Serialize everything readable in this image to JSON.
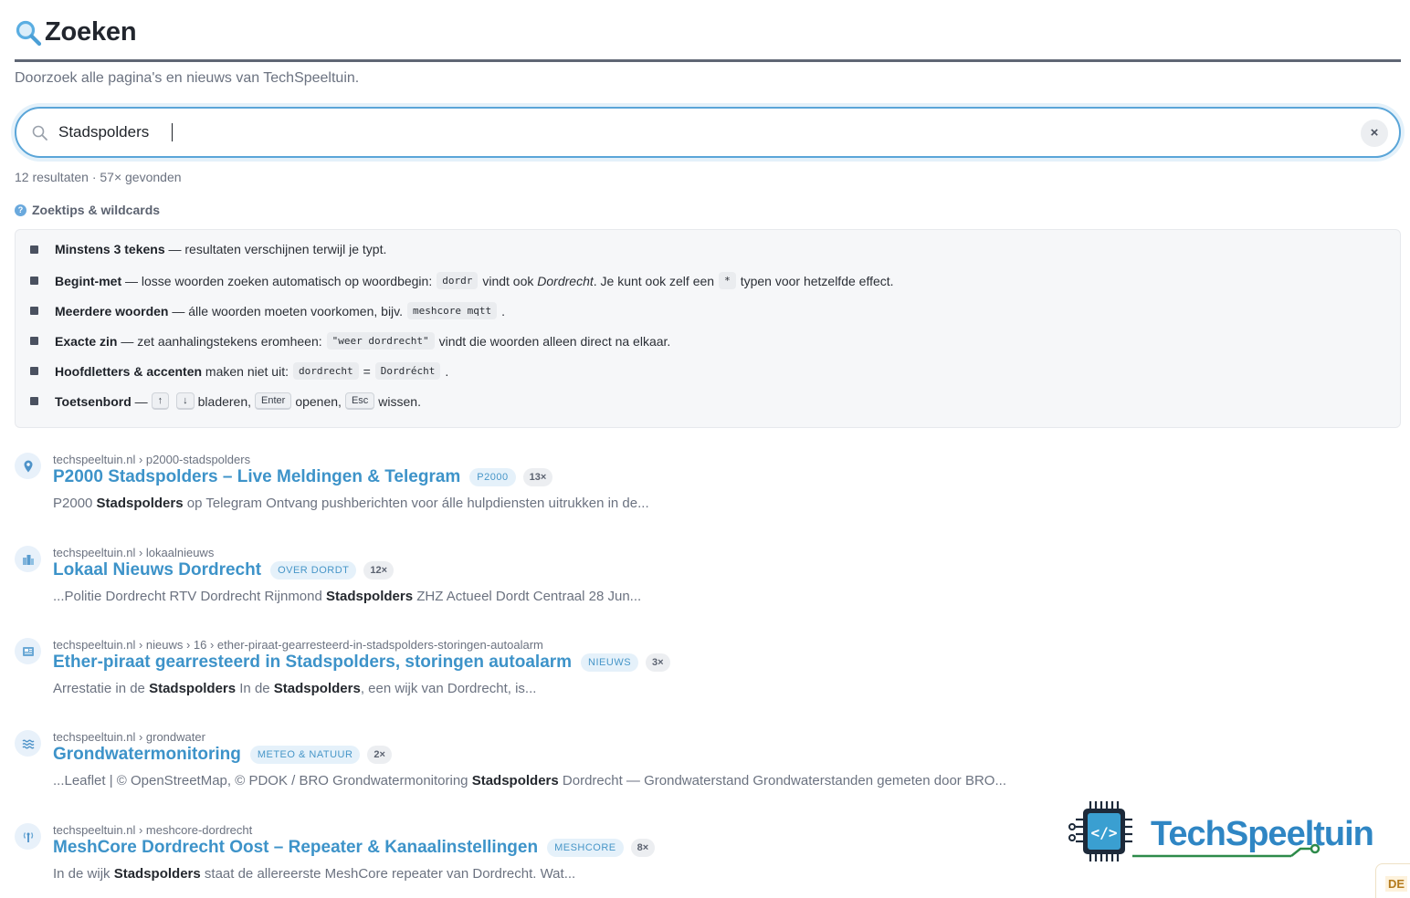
{
  "header": {
    "title": "Zoeken",
    "subtitle": "Doorzoek alle pagina's en nieuws van TechSpeeltuin."
  },
  "search": {
    "value": "Stadspolders",
    "clear_label": "×"
  },
  "meta": {
    "results": "12 resultaten · 57× gevonden"
  },
  "tips": {
    "toggle": "Zoektips & wildcards",
    "toggle_icon": "?",
    "items": [
      {
        "bold": "Minstens 3 tekens",
        "text": " — resultaten verschijnen terwijl je typt."
      },
      {
        "bold": "Begint-met",
        "text_a": " — losse woorden zoeken automatisch op woordbegin:",
        "code_a": "dordr",
        "text_b": "vindt ook ",
        "em": "Dordrecht",
        "text_c": ". Je kunt ook zelf een",
        "code_b": "*",
        "text_d": "typen voor hetzelfde effect."
      },
      {
        "bold": "Meerdere woorden",
        "text_a": " — álle woorden moeten voorkomen, bijv.",
        "code_a": "meshcore mqtt",
        "text_b": "."
      },
      {
        "bold": "Exacte zin",
        "text_a": " — zet aanhalingstekens eromheen:",
        "code_a": "\"weer dordrecht\"",
        "text_b": "vindt die woorden alleen direct na elkaar."
      },
      {
        "bold": "Hoofdletters & accenten",
        "text_a": " maken niet uit:",
        "code_a": "dordrecht",
        "eq": "=",
        "code_b": "Dordrécht",
        "text_b": "."
      },
      {
        "bold": "Toetsenbord",
        "text_a": " —",
        "kbd_a": "↑",
        "kbd_b": "↓",
        "text_b": "bladeren,",
        "kbd_c": "Enter",
        "text_c": "openen,",
        "kbd_d": "Esc",
        "text_d": "wissen."
      }
    ]
  },
  "results": [
    {
      "icon": "map-pin-icon",
      "crumb": "techspeeltuin.nl › p2000-stadspolders",
      "title": "P2000 Stadspolders – Live Meldingen & Telegram",
      "tag": "P2000",
      "count": "13×",
      "snippet": [
        {
          "t": "P2000 "
        },
        {
          "b": "Stadspolders"
        },
        {
          "t": " op Telegram Ontvang pushberichten voor álle hulpdiensten uitrukken in de..."
        }
      ]
    },
    {
      "icon": "city-icon",
      "crumb": "techspeeltuin.nl › lokaalnieuws",
      "title": "Lokaal Nieuws Dordrecht",
      "tag": "Over Dordt",
      "count": "12×",
      "snippet": [
        {
          "t": "...Politie Dordrecht RTV Dordrecht Rijnmond "
        },
        {
          "b": "Stadspolders"
        },
        {
          "t": " ZHZ Actueel Dordt Centraal 28 Jun..."
        }
      ]
    },
    {
      "icon": "newspaper-icon",
      "crumb": "techspeeltuin.nl › nieuws › 16 › ether-piraat-gearresteerd-in-stadspolders-storingen-autoalarm",
      "title": "Ether-piraat gearresteerd in Stadspolders, storingen autoalarm",
      "tag": "Nieuws",
      "count": "3×",
      "snippet": [
        {
          "t": "Arrestatie in de "
        },
        {
          "b": "Stadspolders"
        },
        {
          "t": " In de "
        },
        {
          "b": "Stadspolders"
        },
        {
          "t": ", een wijk van Dordrecht, is..."
        }
      ]
    },
    {
      "icon": "water-icon",
      "crumb": "techspeeltuin.nl › grondwater",
      "title": "Grondwatermonitoring",
      "tag": "Meteo & Natuur",
      "count": "2×",
      "snippet": [
        {
          "t": "...Leaflet | © OpenStreetMap, © PDOK / BRO Grondwatermonitoring "
        },
        {
          "b": "Stadspolders"
        },
        {
          "t": " Dordrecht — Grondwaterstand Grondwaterstanden gemeten door BRO..."
        }
      ]
    },
    {
      "icon": "antenna-icon",
      "crumb": "techspeeltuin.nl › meshcore-dordrecht",
      "title": "MeshCore Dordrecht Oost – Repeater & Kanaalinstellingen",
      "tag": "MeshCore",
      "count": "8×",
      "snippet": [
        {
          "t": "In de wijk "
        },
        {
          "b": "Stadspolders"
        },
        {
          "t": " staat de allereerste MeshCore repeater van Dordrecht. Wat..."
        }
      ]
    }
  ],
  "logo": {
    "text": "TechSpeeltuin"
  },
  "corner_tab": {
    "label": "DE"
  },
  "colors": {
    "accent": "#3d93c9",
    "border": "#5f6674",
    "tag_bg": "#e5f1fa"
  }
}
